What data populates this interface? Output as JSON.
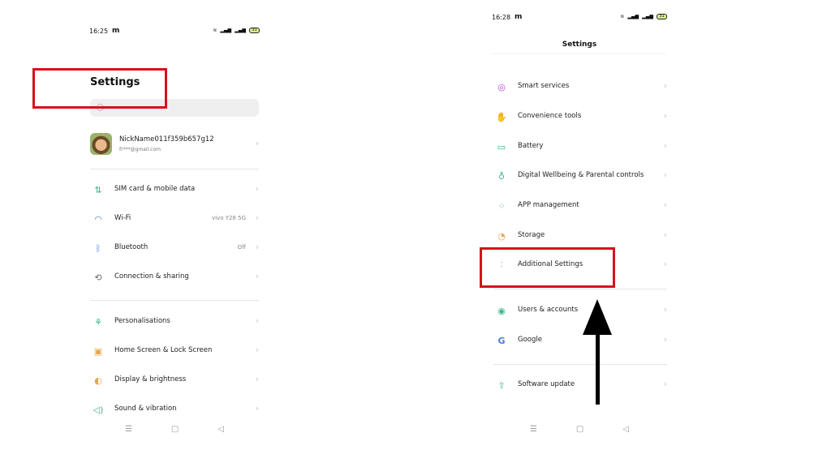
{
  "left_screen": {
    "status": {
      "time": "16:25",
      "carrier": "m",
      "battery": "31"
    },
    "title": "Settings",
    "search_placeholder": "",
    "account": {
      "name": "NickName011f359b657g12",
      "email": "fr***@gmail.com"
    },
    "rows": [
      {
        "label": "SIM card & mobile data",
        "value": "",
        "icon": "sim-data-icon"
      },
      {
        "label": "Wi-Fi",
        "value": "vivo Y28 5G",
        "icon": "wifi-icon"
      },
      {
        "label": "Bluetooth",
        "value": "Off",
        "icon": "bluetooth-icon"
      },
      {
        "label": "Connection & sharing",
        "value": "",
        "icon": "connection-icon"
      },
      {
        "label": "Personalisations",
        "value": "",
        "icon": "personalisation-icon"
      },
      {
        "label": "Home Screen & Lock Screen",
        "value": "",
        "icon": "home-screen-icon"
      },
      {
        "label": "Display & brightness",
        "value": "",
        "icon": "display-icon"
      },
      {
        "label": "Sound & vibration",
        "value": "",
        "icon": "sound-icon"
      }
    ]
  },
  "right_screen": {
    "status": {
      "time": "16:28",
      "carrier": "m",
      "battery": "31"
    },
    "title": "Settings",
    "rows": [
      {
        "label": "Smart services",
        "icon": "smart-services-icon"
      },
      {
        "label": "Convenience tools",
        "icon": "convenience-tools-icon"
      },
      {
        "label": "Battery",
        "icon": "battery-icon"
      },
      {
        "label": "Digital Wellbeing & Parental controls",
        "icon": "wellbeing-icon"
      },
      {
        "label": "APP management",
        "icon": "app-management-icon"
      },
      {
        "label": "Storage",
        "icon": "storage-icon"
      },
      {
        "label": "Additional Settings",
        "icon": "additional-settings-icon"
      },
      {
        "label": "Users & accounts",
        "icon": "users-icon"
      },
      {
        "label": "Google",
        "icon": "google-icon"
      },
      {
        "label": "Software update",
        "icon": "software-update-icon"
      }
    ]
  },
  "colors": {
    "highlight": "#d6121a",
    "arrow": "#000000",
    "accent_green": "#3bb58a"
  }
}
